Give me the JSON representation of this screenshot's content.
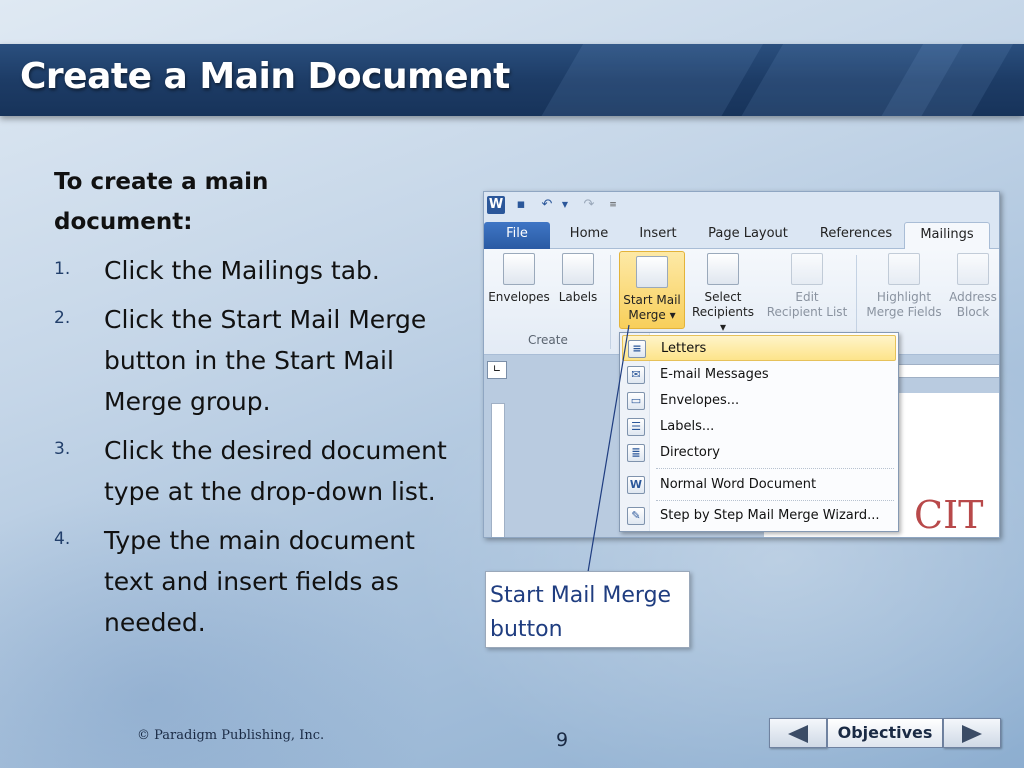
{
  "slide": {
    "title": "Create a Main Document",
    "intro": "To create a main document:",
    "steps": [
      {
        "num": "1.",
        "text": "Click the Mailings tab."
      },
      {
        "num": "2.",
        "text": "Click the Start Mail Merge button in the Start Mail Merge group."
      },
      {
        "num": "3.",
        "text": "Click the desired document type at the drop-down list."
      },
      {
        "num": "4.",
        "text": "Type the main document text and insert fields as needed."
      }
    ],
    "callout": "Start Mail Merge button"
  },
  "word": {
    "tabs": [
      "File",
      "Home",
      "Insert",
      "Page Layout",
      "References",
      "Mailings"
    ],
    "ribbon": {
      "envelopes": "Envelopes",
      "labels": "Labels",
      "start_mail_merge_line1": "Start Mail",
      "start_mail_merge_line2": "Merge ▾",
      "select_recipients_line1": "Select",
      "select_recipients_line2": "Recipients ▾",
      "edit_recipient_line1": "Edit",
      "edit_recipient_line2": "Recipient List",
      "highlight_line1": "Highlight",
      "highlight_line2": "Merge Fields",
      "address_line1": "Address",
      "address_line2": "Block",
      "create_group": "Create"
    },
    "menu": [
      "Letters",
      "E-mail Messages",
      "Envelopes...",
      "Labels...",
      "Directory",
      "Normal Word Document",
      "Step by Step Mail Merge Wizard..."
    ],
    "document_text": "CIT"
  },
  "footer": {
    "copyright": "© Paradigm Publishing, Inc.",
    "page_number": "9",
    "objectives": "Objectives"
  }
}
